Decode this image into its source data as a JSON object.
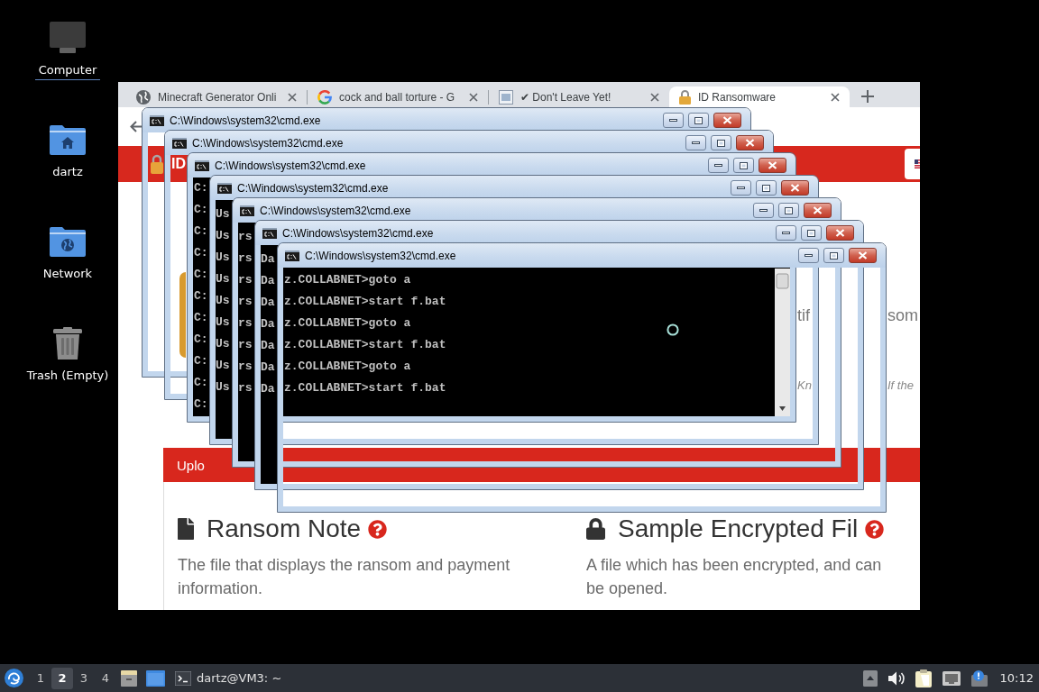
{
  "desktop_icons": [
    {
      "label": "Computer",
      "kind": "computer",
      "selected": true
    },
    {
      "label": "dartz",
      "kind": "home_folder",
      "selected": false
    },
    {
      "label": "Network",
      "kind": "network_folder",
      "selected": false
    },
    {
      "label": "Trash (Empty)",
      "kind": "trash",
      "selected": false
    }
  ],
  "browser": {
    "tabs": [
      {
        "title": "Minecraft Generator Onli",
        "kind": "globe",
        "selected": false
      },
      {
        "title": "cock and ball torture - G",
        "kind": "g_logo",
        "selected": false
      },
      {
        "title": "✔ Don't Leave Yet!",
        "kind": "page",
        "selected": false
      },
      {
        "title": "ID Ransomware",
        "kind": "padlock",
        "selected": true
      }
    ],
    "page": {
      "logo_text": "ID",
      "fragment_rows": [
        {
          "kind": "body",
          "texts": [
            "tif",
            "som"
          ]
        },
        {
          "kind": "note",
          "texts": [
            "Kn",
            "If the"
          ]
        }
      ],
      "upload_bar": "Uplo",
      "cards": [
        {
          "kind": "file",
          "heading": "Ransom Note",
          "description": "The file that displays the ransom and payment\ninformation."
        },
        {
          "kind": "lock",
          "heading": "Sample Encrypted Fil",
          "description": "A file which has been encrypted, and can\nbe opened."
        }
      ]
    }
  },
  "cmd_windows": [
    {
      "title": "C:\\Windows\\system32\\cmd.exe",
      "kind": "frame"
    },
    {
      "title": "C:\\Windows\\system32\\cmd.exe",
      "kind": "frame"
    },
    {
      "title": "C:\\Windows\\system32\\cmd.exe",
      "kind": "console",
      "lines": [
        "C:",
        "C:",
        "C:",
        "C:",
        "C:",
        "C:",
        "C:",
        "C:",
        "C:",
        "C:",
        "C:"
      ]
    },
    {
      "title": "C:\\Windows\\system32\\cmd.exe",
      "kind": "strip",
      "lines": [
        "Us",
        "Us",
        "Us",
        "Us",
        "Us",
        "Us",
        "Us",
        "Us",
        "Us"
      ]
    },
    {
      "title": "C:\\Windows\\system32\\cmd.exe",
      "kind": "strip",
      "lines": [
        "rs",
        "rs",
        "rs",
        "rs",
        "rs",
        "rs",
        "rs",
        "rs"
      ]
    },
    {
      "title": "C:\\Windows\\system32\\cmd.exe",
      "kind": "strip",
      "lines": [
        "Da",
        "Da",
        "Da",
        "Da",
        "Da",
        "Da",
        "Da"
      ]
    },
    {
      "title": "C:\\Windows\\system32\\cmd.exe",
      "kind": "panel",
      "lines": [
        "z.COLLABNET>goto a",
        "z.COLLABNET>start f.bat",
        "z.COLLABNET>goto a",
        "z.COLLABNET>start f.bat",
        "z.COLLABNET>goto a",
        "z.COLLABNET>start f.bat"
      ]
    }
  ],
  "taskbar": {
    "workspaces": [
      {
        "label": "1",
        "selected": false
      },
      {
        "label": "2",
        "selected": true
      },
      {
        "label": "3",
        "selected": false
      },
      {
        "label": "4",
        "selected": false
      }
    ],
    "tasks": [
      {
        "label": "dartz@VM3: ~"
      }
    ],
    "clock": "10:12"
  }
}
